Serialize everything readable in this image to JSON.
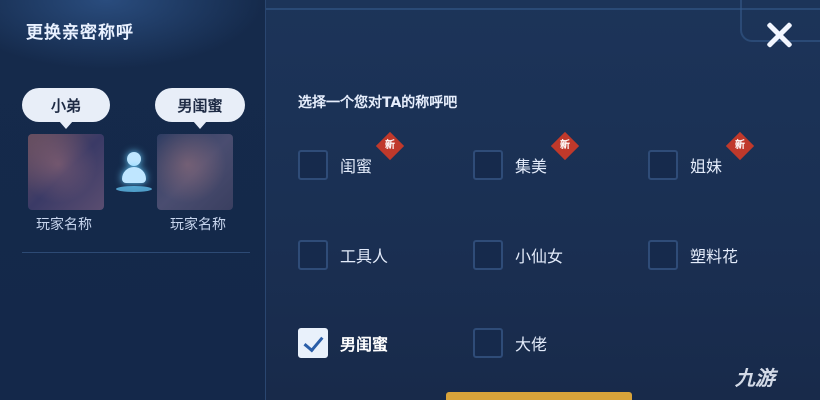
{
  "dialog": {
    "title": "更换亲密称呼"
  },
  "players": [
    {
      "bubble": "小弟",
      "name": "玩家名称"
    },
    {
      "bubble": "男闺蜜",
      "name": "玩家名称"
    }
  ],
  "prompt": "选择一个您对TA的称呼吧",
  "new_badge": "新",
  "options": [
    {
      "label": "闺蜜",
      "is_new": true,
      "checked": false
    },
    {
      "label": "集美",
      "is_new": true,
      "checked": false
    },
    {
      "label": "姐妹",
      "is_new": true,
      "checked": false
    },
    {
      "label": "工具人",
      "is_new": false,
      "checked": false
    },
    {
      "label": "小仙女",
      "is_new": false,
      "checked": false
    },
    {
      "label": "塑料花",
      "is_new": false,
      "checked": false
    },
    {
      "label": "男闺蜜",
      "is_new": false,
      "checked": true
    },
    {
      "label": "大佬",
      "is_new": false,
      "checked": false
    }
  ],
  "watermark": "九游",
  "icons": {
    "close": "close-icon",
    "center": "intimacy-person-icon"
  }
}
